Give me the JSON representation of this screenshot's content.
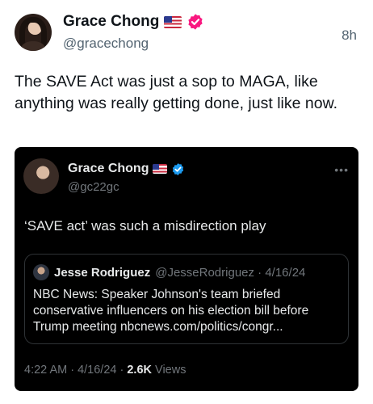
{
  "post": {
    "author": {
      "name": "Grace Chong",
      "handle": "@gracechong",
      "flag_icon": "us-flag-icon",
      "verified_icon": "verified-badge-icon",
      "verified_color": "#f91880"
    },
    "time": "8h",
    "text": "The SAVE Act was just a sop to MAGA, like anything was really getting done, just like now."
  },
  "embed": {
    "background": "#000000",
    "author": {
      "name": "Grace Chong",
      "handle": "@gc22gc",
      "flag_icon": "us-flag-icon",
      "verified_icon": "verified-badge-icon",
      "verified_color": "#1d9bf0"
    },
    "more_icon": "more-horizontal-icon",
    "text": "‘SAVE act’ was such a misdirection play",
    "quote": {
      "name": "Jesse Rodriguez",
      "meta": "@JesseRodriguez · 4/16/24",
      "text": "NBC News: Speaker Johnson's team briefed conservative influencers on his election bill before Trump meeting nbcnews.com/politics/congr..."
    },
    "footer": {
      "timestamp": "4:22 AM · 4/16/24 · ",
      "views_count": "2.6K",
      "views_label": " Views"
    }
  }
}
